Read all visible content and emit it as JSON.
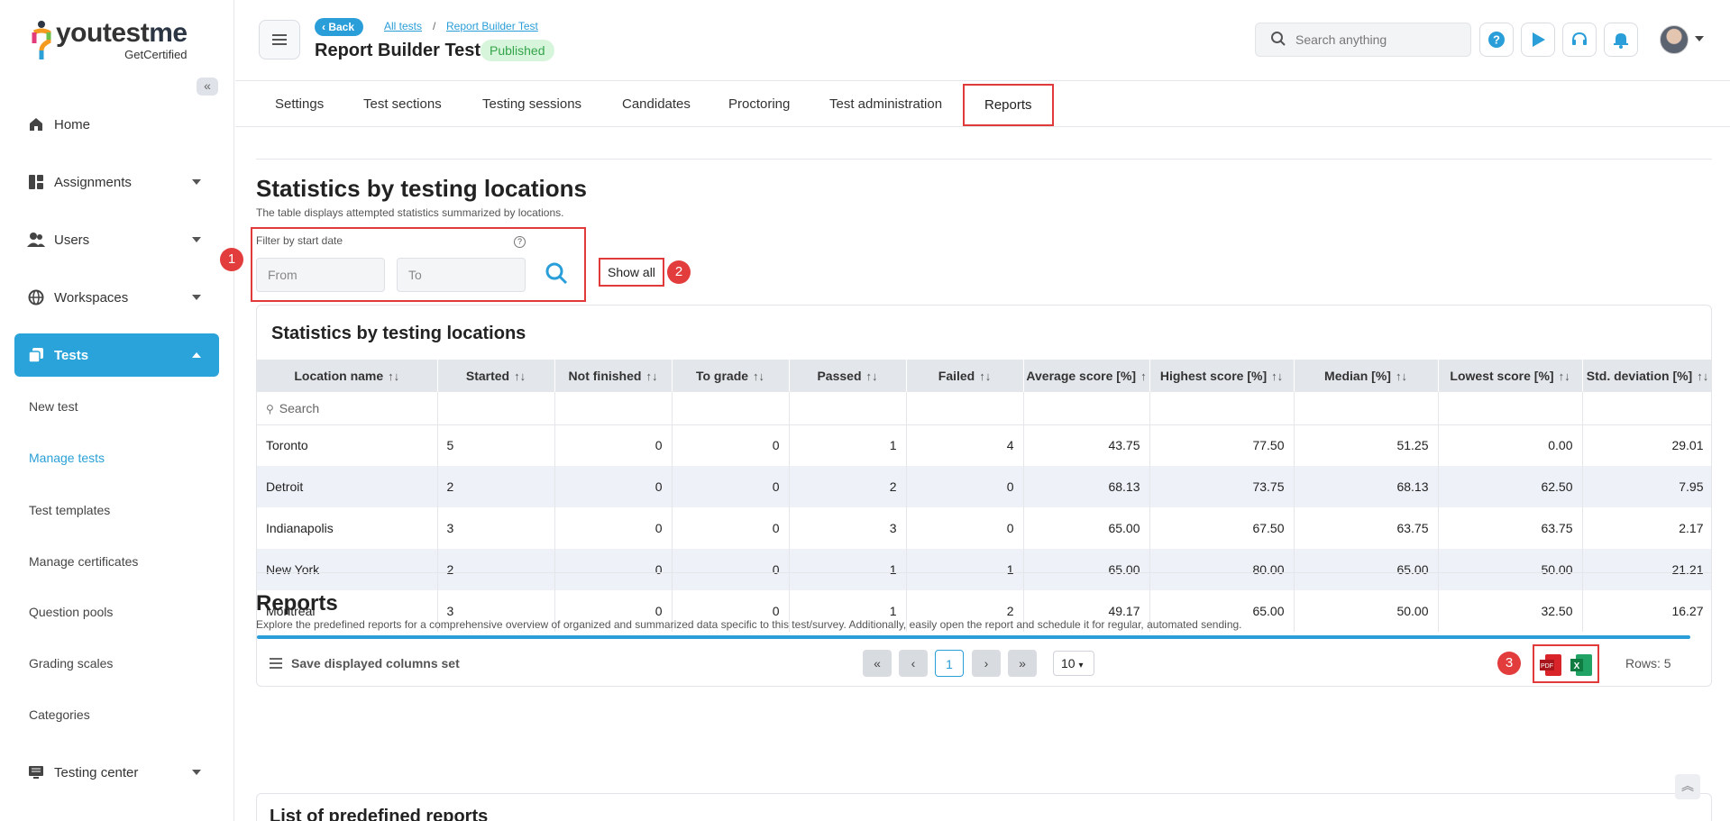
{
  "brand": {
    "name_main": "youtest",
    "name_accent": "me",
    "tagline": "GetCertified"
  },
  "sidebar": {
    "items": [
      {
        "label": "Home",
        "icon": "home-icon"
      },
      {
        "label": "Assignments",
        "icon": "assignments-icon"
      },
      {
        "label": "Users",
        "icon": "users-icon"
      },
      {
        "label": "Workspaces",
        "icon": "globe-icon"
      },
      {
        "label": "Tests",
        "icon": "tests-icon"
      }
    ],
    "sub_items": [
      "New test",
      "Manage tests",
      "Test templates",
      "Manage certificates",
      "Question pools",
      "Grading scales",
      "Categories"
    ],
    "bottom_item": {
      "label": "Testing center",
      "icon": "monitor-icon"
    }
  },
  "header": {
    "back_label": "Back",
    "crumbs": [
      "All tests",
      "Report Builder Test"
    ],
    "crumb_sep": "/",
    "title": "Report Builder Test",
    "status": "Published",
    "search_placeholder": "Search anything"
  },
  "tabs": [
    "Settings",
    "Test sections",
    "Testing sessions",
    "Candidates",
    "Proctoring",
    "Test administration",
    "Reports"
  ],
  "stats": {
    "title": "Statistics by testing locations",
    "description": "The table displays attempted statistics summarized by locations.",
    "filter_label": "Filter by start date",
    "from_placeholder": "From",
    "to_placeholder": "To",
    "show_all": "Show all",
    "markers": [
      "1",
      "2",
      "3"
    ],
    "card_title": "Statistics by testing locations",
    "columns": [
      "Location name",
      "Started",
      "Not finished",
      "To grade",
      "Passed",
      "Failed",
      "Average score [%]",
      "Highest score [%]",
      "Median [%]",
      "Lowest score [%]",
      "Std. deviation [%]"
    ],
    "search_placeholder": "Search",
    "rows": [
      [
        "Toronto",
        "5",
        "0",
        "0",
        "1",
        "4",
        "43.75",
        "77.50",
        "51.25",
        "0.00",
        "29.01"
      ],
      [
        "Detroit",
        "2",
        "0",
        "0",
        "2",
        "0",
        "68.13",
        "73.75",
        "68.13",
        "62.50",
        "7.95"
      ],
      [
        "Indianapolis",
        "3",
        "0",
        "0",
        "3",
        "0",
        "65.00",
        "67.50",
        "63.75",
        "63.75",
        "2.17"
      ],
      [
        "New York",
        "2",
        "0",
        "0",
        "1",
        "1",
        "65.00",
        "80.00",
        "65.00",
        "50.00",
        "21.21"
      ],
      [
        "Montreal",
        "3",
        "0",
        "0",
        "1",
        "2",
        "49.17",
        "65.00",
        "50.00",
        "32.50",
        "16.27"
      ]
    ],
    "save_columns": "Save displayed columns set",
    "page_current": "1",
    "page_size": "10",
    "rows_count": "Rows: 5"
  },
  "reports": {
    "title": "Reports",
    "description": "Explore the predefined reports for a comprehensive overview of organized and summarized data specific to this test/survey. Additionally, easily open the report and schedule it for regular, automated sending.",
    "list_title": "List of predefined reports"
  },
  "colors": {
    "accent": "#29a3d9",
    "highlight": "#e03a3a",
    "published_bg": "#d7f5db",
    "published_text": "#34a44b"
  }
}
